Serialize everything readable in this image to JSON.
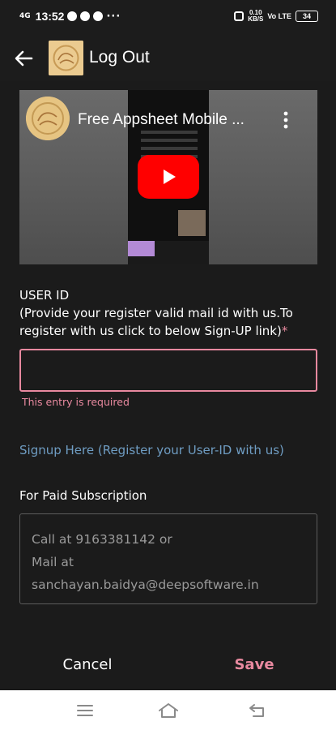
{
  "status_bar": {
    "signal_text": "4G",
    "time": "13:52",
    "more_indicator": "···",
    "speed_value": "0.10",
    "speed_unit": "KB/S",
    "wifi_text": "Vo LTE",
    "battery": "34"
  },
  "header": {
    "title": "Log Out",
    "back_icon": "arrow-left-icon"
  },
  "video": {
    "title": "Free Appsheet Mobile ...",
    "play_icon": "youtube-play-icon",
    "menu_icon": "more-vert-icon"
  },
  "form": {
    "user_id_label": "USER ID",
    "user_id_hint": "(Provide your register valid mail id with us.To register with us click to below Sign-UP link)",
    "required_marker": "*",
    "user_id_value": "",
    "error_text": "This entry is required",
    "signup_link": "Signup Here (Register your User-ID with us)",
    "paid_label": "For Paid Subscription",
    "paid_lines": [
      "Call at 9163381142 or",
      "Mail at",
      "sanchayan.baidya@deepsoftware.in"
    ]
  },
  "footer": {
    "cancel_label": "Cancel",
    "save_label": "Save"
  },
  "colors": {
    "accent_pink": "#e8899f",
    "link_blue": "#6f9dc3",
    "background": "#1b1b1b"
  }
}
